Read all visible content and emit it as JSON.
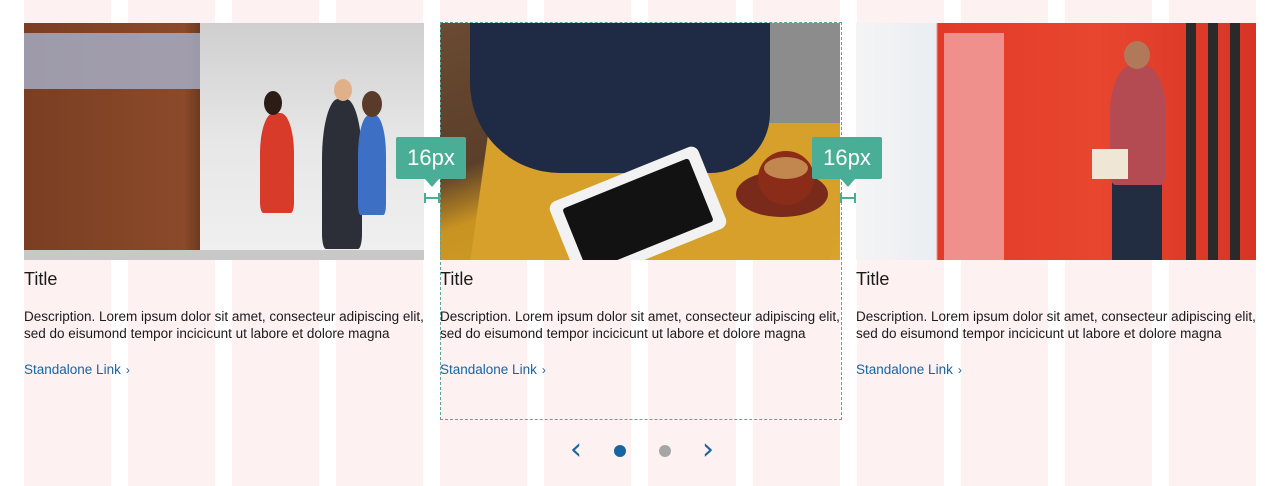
{
  "overlay": {
    "spacing_label_left": "16px",
    "spacing_label_right": "16px",
    "accent_color": "#4aae96",
    "grid_column_color": "#fdf1f2"
  },
  "cards": [
    {
      "image": "office-meeting-photo",
      "title": "Title",
      "description": "Description. Lorem ipsum dolor sit amet, consecteur adipiscing elit, sed do eisumond tempor incicicunt ut labore et dolore magna",
      "link": "Standalone Link",
      "link_icon": "chevron-right-icon"
    },
    {
      "image": "tablet-coffee-photo",
      "title": "Title",
      "description": "Description. Lorem ipsum dolor sit amet, consecteur adipiscing elit, sed do eisumond tempor incicicunt ut labore et dolore magna",
      "link": "Standalone Link",
      "link_icon": "chevron-right-icon"
    },
    {
      "image": "man-walking-red-wall-photo",
      "title": "Title",
      "description": "Description. Lorem ipsum dolor sit amet, consecteur adipiscing elit, sed do eisumond tempor incicicunt ut labore et dolore magna",
      "link": "Standalone Link",
      "link_icon": "chevron-right-icon"
    }
  ],
  "pagination": {
    "prev_icon": "‹",
    "next_icon": "›",
    "active_color": "#1765a0",
    "inactive_color": "#a6a6a6",
    "current_page": 1,
    "total_pages": 2
  },
  "link_color": "#1765a0"
}
